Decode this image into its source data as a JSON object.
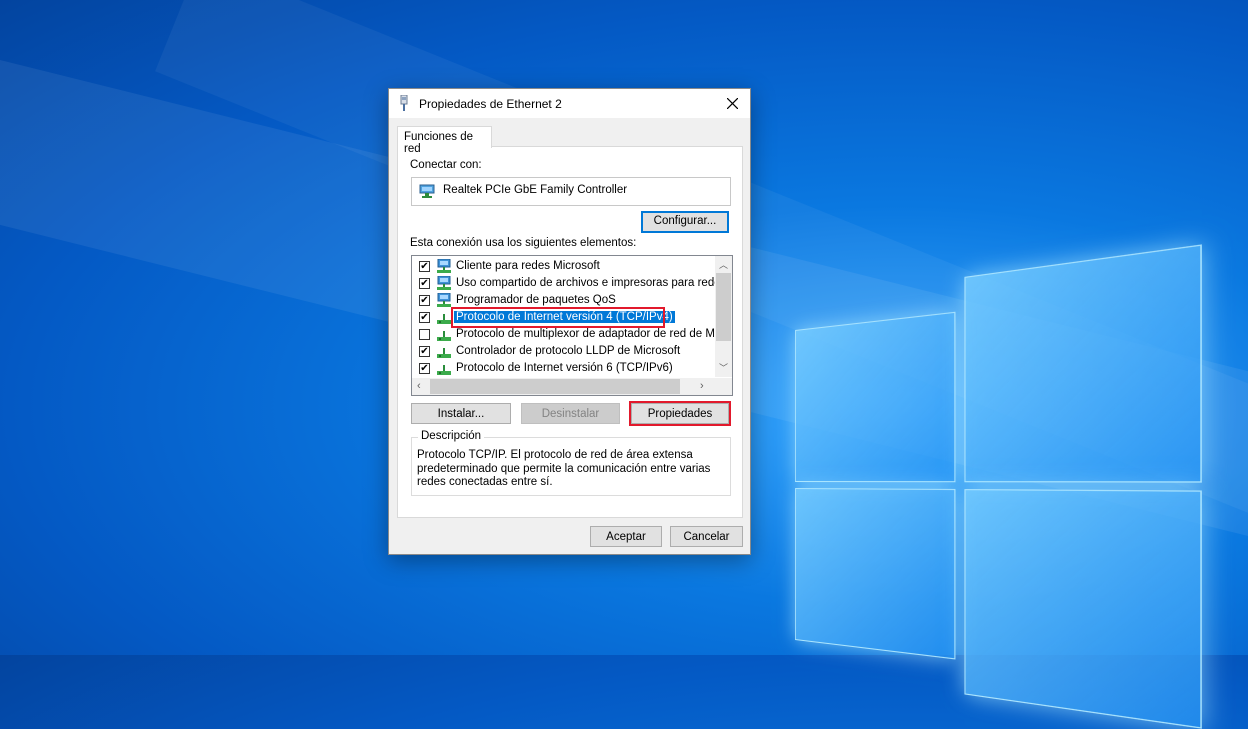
{
  "dialog": {
    "title": "Propiedades de Ethernet 2",
    "tab_label": "Funciones de red",
    "connect_label": "Conectar con:",
    "adapter_name": "Realtek PCIe GbE Family Controller",
    "configure_label": "Configurar...",
    "elements_label": "Esta conexión usa los siguientes elementos:",
    "items": [
      {
        "label": "Cliente para redes Microsoft",
        "checked": true,
        "icon": "network-client-icon"
      },
      {
        "label": "Uso compartido de archivos e impresoras para redes M",
        "checked": true,
        "icon": "network-client-icon"
      },
      {
        "label": "Programador de paquetes QoS",
        "checked": true,
        "icon": "network-client-icon"
      },
      {
        "label": "Protocolo de Internet versión 4 (TCP/IPv4)",
        "checked": true,
        "icon": "protocol-icon",
        "selected": true
      },
      {
        "label": "Protocolo de multiplexor de adaptador de red de Micros",
        "checked": false,
        "icon": "protocol-icon"
      },
      {
        "label": "Controlador de protocolo LLDP de Microsoft",
        "checked": true,
        "icon": "protocol-icon"
      },
      {
        "label": "Protocolo de Internet versión 6 (TCP/IPv6)",
        "checked": true,
        "icon": "protocol-icon"
      }
    ],
    "install_label": "Instalar...",
    "uninstall_label": "Desinstalar",
    "properties_label": "Propiedades",
    "description_title": "Descripción",
    "description_text": "Protocolo TCP/IP. El protocolo de red de área extensa predeterminado que permite la comunicación entre varias redes conectadas entre sí.",
    "ok_label": "Aceptar",
    "cancel_label": "Cancelar"
  },
  "colors": {
    "selection": "#0078d7",
    "highlight_box": "#e2192c",
    "desktop": "#0a78e0"
  }
}
